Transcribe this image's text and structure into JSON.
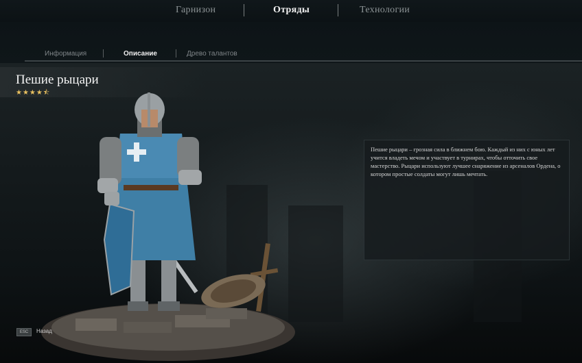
{
  "top_tabs": [
    {
      "label": "Гарнизон",
      "active": false
    },
    {
      "label": "Отряды",
      "active": true
    },
    {
      "label": "Технологии",
      "active": false
    }
  ],
  "sub_tabs": [
    {
      "label": "Информация",
      "active": false
    },
    {
      "label": "Описание",
      "active": true
    },
    {
      "label": "Древо талантов",
      "active": false
    }
  ],
  "unit": {
    "name": "Пешие рыцари",
    "stars": "★★★★⯪",
    "rating": 4.5,
    "description": "Пешие рыцари – грозная сила в ближнем бою. Каждый из них с юных лет учится владеть мечом и участвует в турнирах, чтобы отточить свое мастерство. Рыцари используют лучшее снаряжение из арсеналов Ордена, о котором простые солдаты могут лишь мечтать."
  },
  "footer": {
    "key": "ESC",
    "back_label": "Назад"
  },
  "colors": {
    "accent_star": "#e8c060",
    "tabard": "#3f7fa6"
  }
}
